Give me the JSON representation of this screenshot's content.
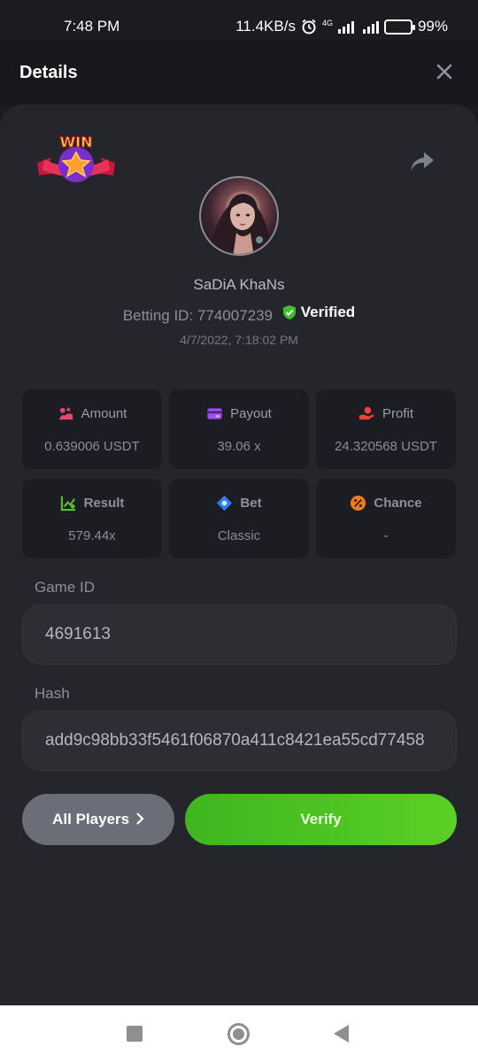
{
  "status_bar": {
    "time": "7:48 PM",
    "speed": "11.4KB/s",
    "network": "4G",
    "battery": "99%"
  },
  "header": {
    "title": "Details"
  },
  "profile": {
    "username": "SaDiA KhaNs",
    "betting_id_label": "Betting ID:",
    "betting_id": "774007239",
    "verified_label": "Verified",
    "timestamp": "4/7/2022, 7:18:02 PM",
    "badge_text": "WIN"
  },
  "stats": [
    {
      "label": "Amount",
      "value": "0.639006 USDT",
      "icon": "amount-icon",
      "color": "#e8466e"
    },
    {
      "label": "Payout",
      "value": "39.06 x",
      "icon": "payout-icon",
      "color": "#9b4cf2"
    },
    {
      "label": "Profit",
      "value": "24.320568 USDT",
      "icon": "profit-icon",
      "color": "#e8463a"
    },
    {
      "label": "Result",
      "value": "579.44x",
      "icon": "result-icon",
      "color": "#56c22c"
    },
    {
      "label": "Bet",
      "value": "Classic",
      "icon": "bet-icon",
      "color": "#2f7bf0"
    },
    {
      "label": "Chance",
      "value": "-",
      "icon": "chance-icon",
      "color": "#f07a1e"
    }
  ],
  "game": {
    "game_id_label": "Game ID",
    "game_id": "4691613",
    "hash_label": "Hash",
    "hash": "add9c98bb33f5461f06870a411c8421ea55cd77458"
  },
  "actions": {
    "all_players": "All Players",
    "verify": "Verify"
  }
}
